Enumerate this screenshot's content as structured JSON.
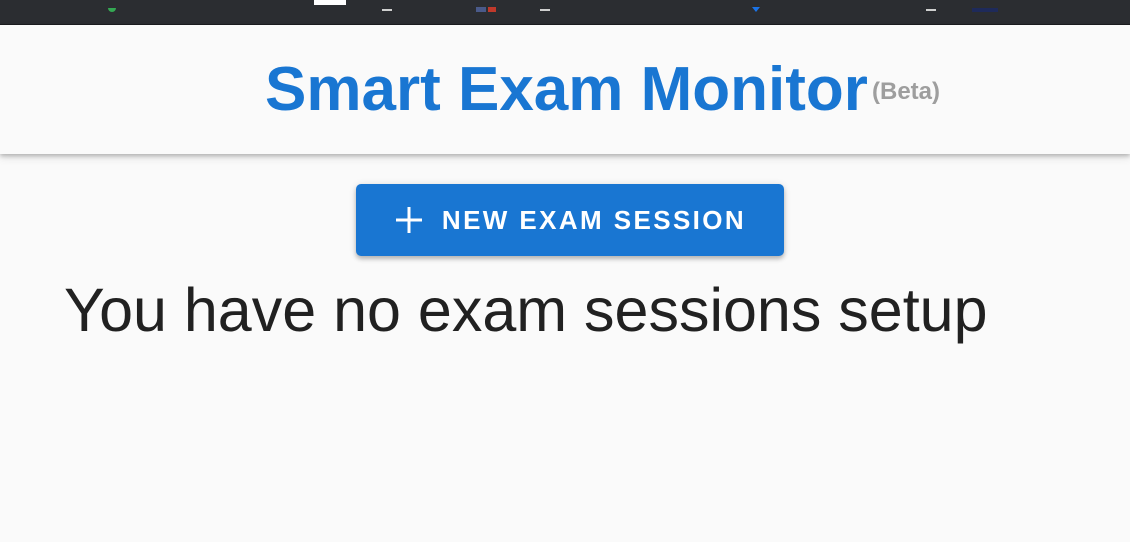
{
  "header": {
    "title": "Smart Exam Monitor",
    "badge": "(Beta)"
  },
  "actions": {
    "new_session_label": "NEW EXAM SESSION",
    "new_session_icon": "plus-icon"
  },
  "main": {
    "empty_message": "You have no exam sessions setup"
  },
  "colors": {
    "primary": "#1976d2",
    "badge": "#9e9e9e",
    "background": "#fafafa",
    "text": "#212121",
    "browser_bar": "#2b2d31"
  }
}
